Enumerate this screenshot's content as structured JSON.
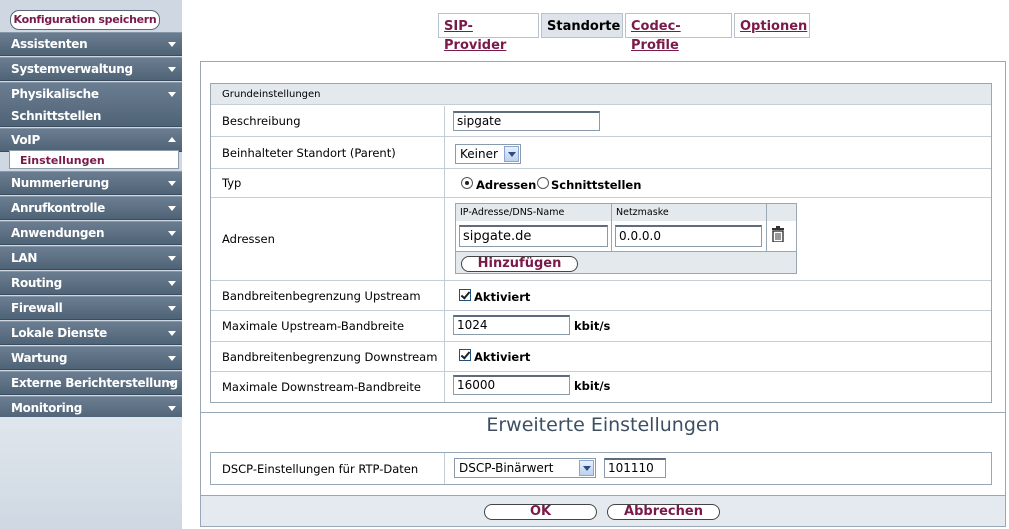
{
  "sidebar": {
    "save_button": "Konfiguration speichern",
    "items": [
      {
        "label": "Assistenten"
      },
      {
        "label": "Systemverwaltung"
      },
      {
        "label": "Physikalische Schnittstellen"
      },
      {
        "label": "VoIP"
      },
      {
        "label": "Nummerierung"
      },
      {
        "label": "Anrufkontrolle"
      },
      {
        "label": "Anwendungen"
      },
      {
        "label": "LAN"
      },
      {
        "label": "Routing"
      },
      {
        "label": "Firewall"
      },
      {
        "label": "Lokale Dienste"
      },
      {
        "label": "Wartung"
      },
      {
        "label": "Externe Berichterstellung"
      },
      {
        "label": "Monitoring"
      }
    ],
    "physik_line1": "Physikalische",
    "physik_line2": "Schnittstellen",
    "voip_sub": "Einstellungen"
  },
  "tabs": [
    {
      "label": "SIP-Provider"
    },
    {
      "label": "Standorte"
    },
    {
      "label": "Codec-Profile"
    },
    {
      "label": "Optionen"
    }
  ],
  "form": {
    "section": "Grundeinstellungen",
    "beschreibung_label": "Beschreibung",
    "beschreibung_value": "sipgate",
    "parent_label": "Beinhalteter Standort (Parent)",
    "parent_value": "Keiner",
    "typ_label": "Typ",
    "typ_opt1": "Adressen",
    "typ_opt2": "Schnittstellen",
    "adressen_label": "Adressen",
    "addr_col1": "IP-Adresse/DNS-Name",
    "addr_col2": "Netzmaske",
    "addr_ip": "sipgate.de",
    "addr_mask": "0.0.0.0",
    "add_button": "Hinzufügen",
    "bw_up_label": "Bandbreitenbegrenzung Upstream",
    "bw_up_check": "Aktiviert",
    "max_up_label": "Maximale Upstream-Bandbreite",
    "max_up_value": "1024",
    "max_up_unit": "kbit/s",
    "bw_down_label": "Bandbreitenbegrenzung Downstream",
    "bw_down_check": "Aktiviert",
    "max_down_label": "Maximale Downstream-Bandbreite",
    "max_down_value": "16000",
    "max_down_unit": "kbit/s"
  },
  "advanced": {
    "title": "Erweiterte Einstellungen",
    "dscp_label": "DSCP-Einstellungen für RTP-Daten",
    "dscp_select": "DSCP-Binärwert",
    "dscp_value": "101110"
  },
  "buttons": {
    "ok": "OK",
    "cancel": "Abbrechen"
  }
}
